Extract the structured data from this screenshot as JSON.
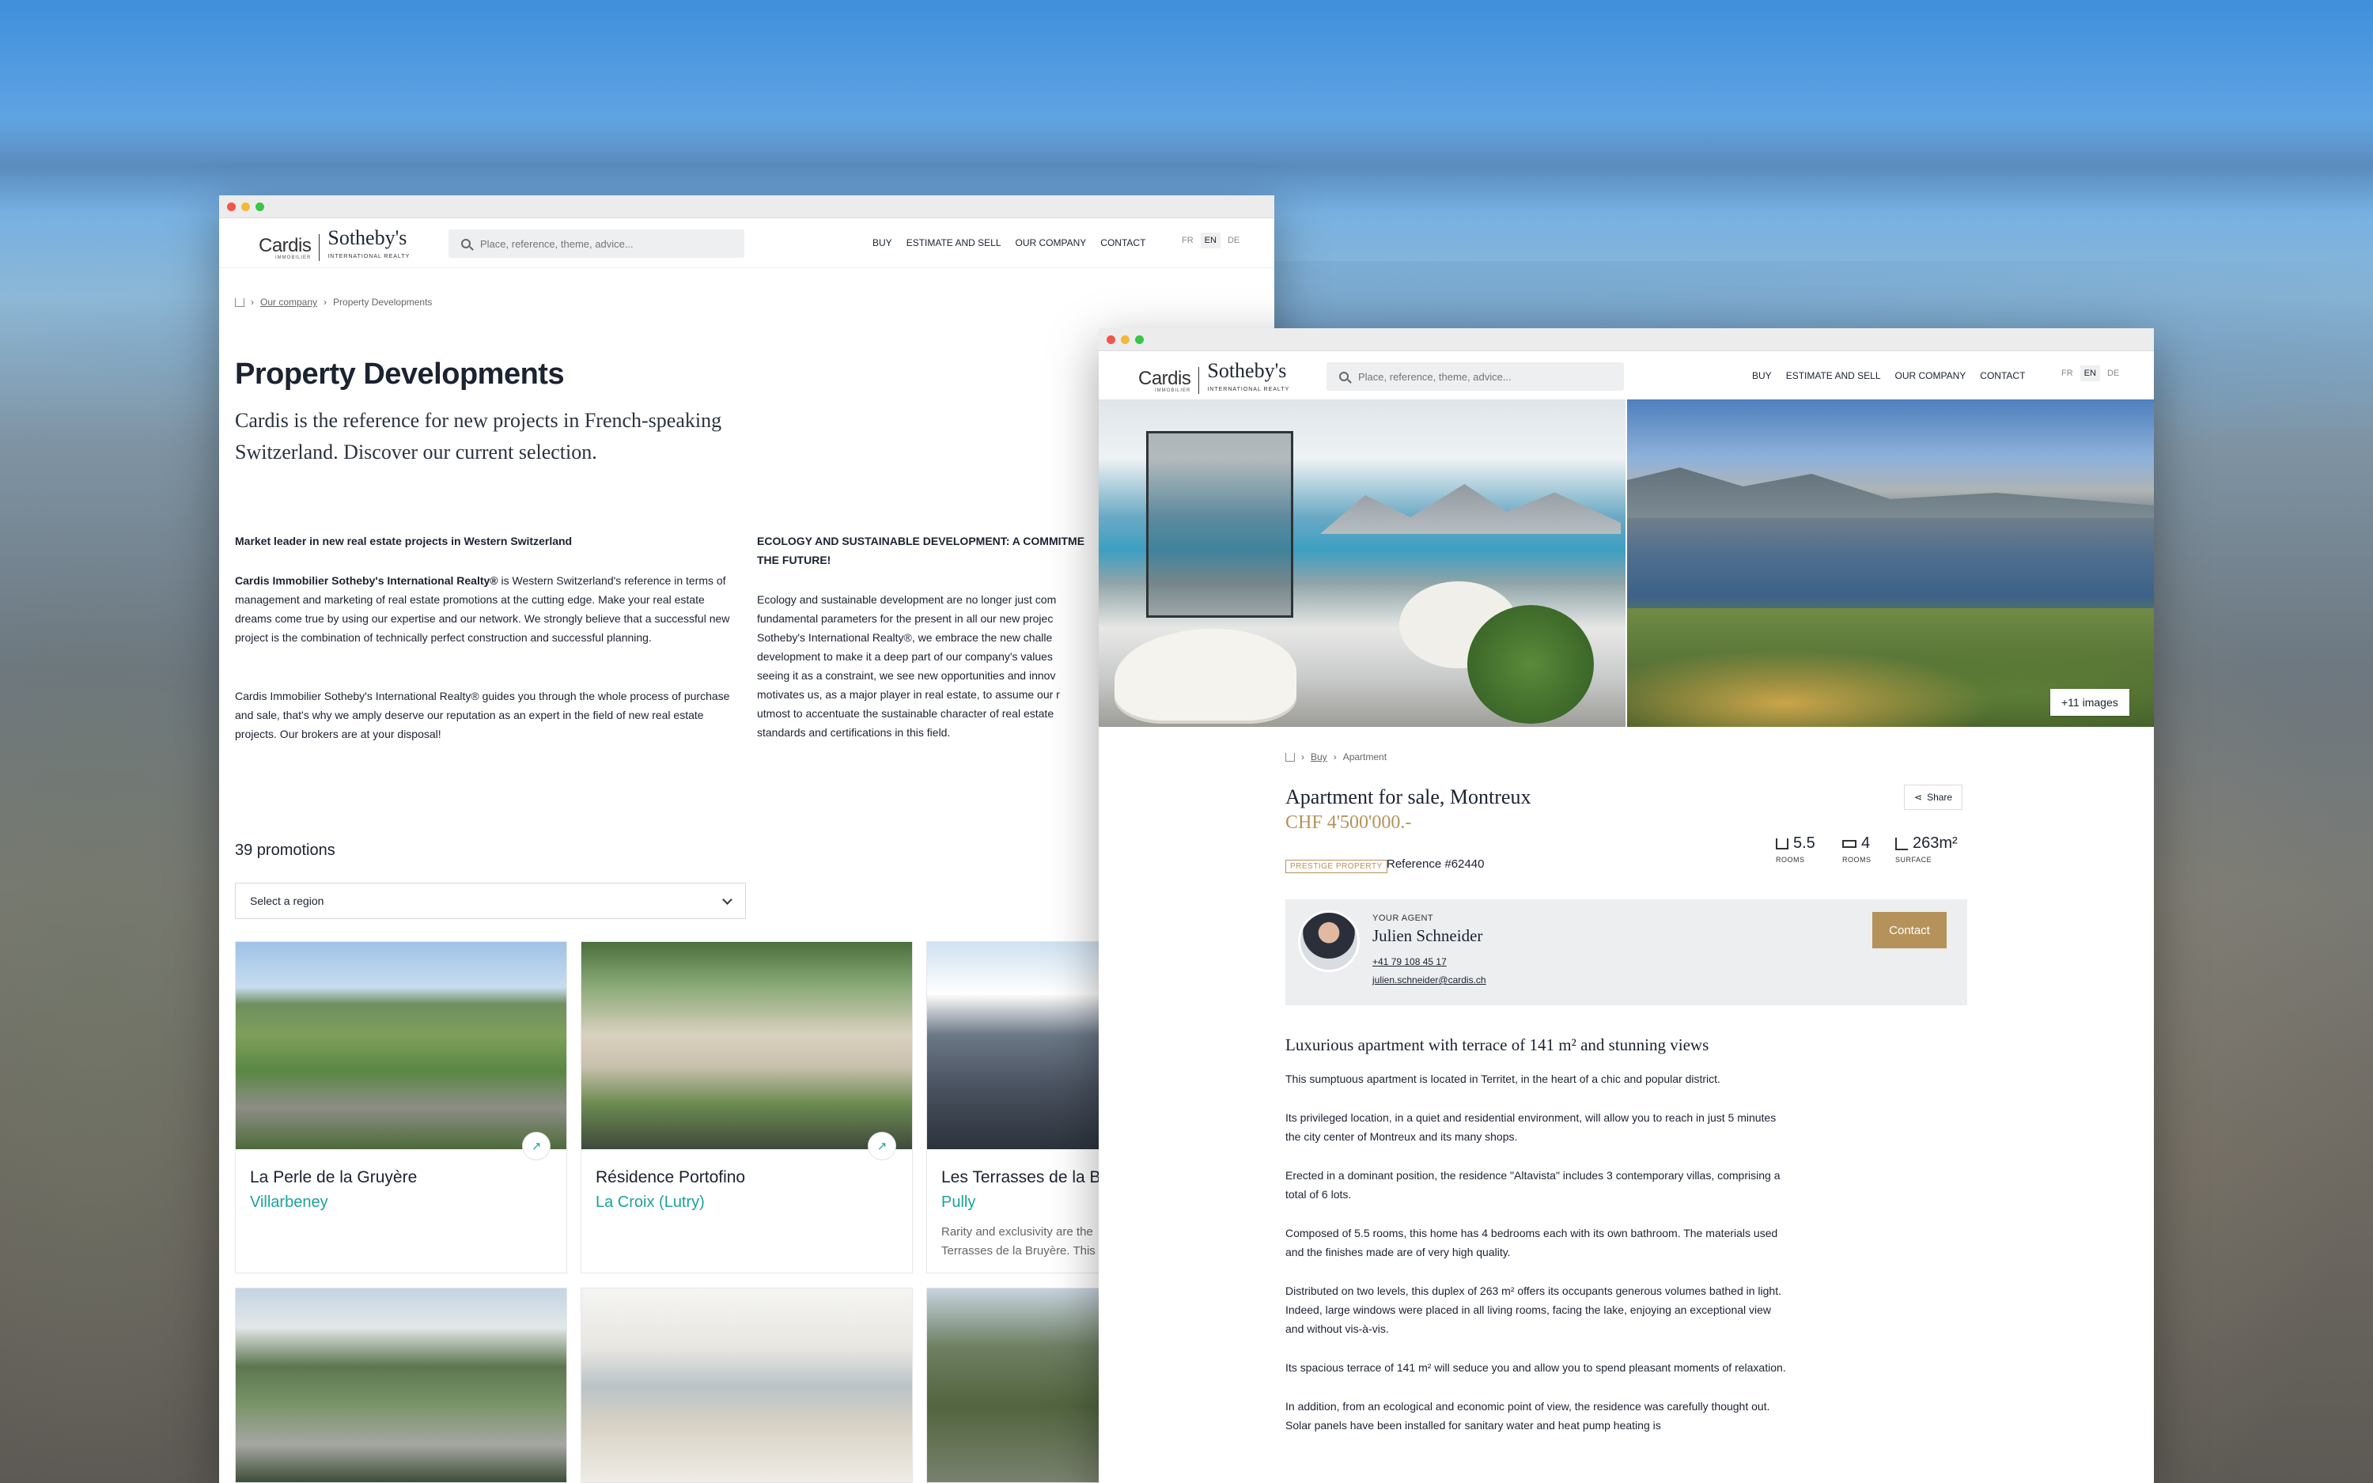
{
  "colors": {
    "teal": "#1aa39a",
    "gold": "#b6925b",
    "text": "#1b2230"
  },
  "brand": {
    "cardis": "Cardis",
    "cardis_sub": "IMMOBILIER",
    "sothebys": "Sotheby's",
    "sothebys_sub": "INTERNATIONAL REALTY"
  },
  "search": {
    "placeholder": "Place, reference, theme, advice..."
  },
  "nav": {
    "buy": "BUY",
    "estimate": "ESTIMATE AND SELL",
    "company": "OUR COMPANY",
    "contact": "CONTACT"
  },
  "langs": {
    "fr": "FR",
    "en": "EN",
    "de": "DE",
    "active": "EN"
  },
  "left": {
    "breadcrumb": {
      "company": "Our company",
      "current": "Property Developments"
    },
    "title": "Property Developments",
    "lede": "Cardis is the reference for new projects in French-speaking Switzerland. Discover our current selection.",
    "col1_heading": "Market leader in new real estate projects in Western Switzerland",
    "col1_p1_bold": "Cardis Immobilier Sotheby's International Realty®",
    "col1_p1_rest": " is Western Switzerland's reference in terms of management and marketing of real estate promotions at the cutting edge. Make your real estate dreams come true by using our expertise and our network. We strongly believe that a successful new project is the combination of technically perfect construction and successful planning.",
    "col1_p2": "Cardis Immobilier Sotheby's International Realty® guides you through the whole process of purchase and sale, that's why we amply deserve our reputation as an expert in the field of new real estate projects. Our brokers are at your disposal!",
    "col2_heading": "ECOLOGY AND SUSTAINABLE DEVELOPMENT: A COMMITME THE FUTURE!",
    "col2_lines": [
      "Ecology and sustainable development are no longer just com",
      "fundamental parameters for the present in all our new projec",
      "Sotheby's International Realty®, we embrace the new challe",
      "development to make it a deep part of our company's values",
      "seeing it as a constraint, we see new opportunities and innov",
      "motivates us, as a major player in real estate, to assume our r",
      "utmost to accentuate the sustainable character of real estate",
      "standards and certifications in this field."
    ],
    "promotions_count": "39 promotions",
    "region_select": "Select a region",
    "cards": [
      {
        "name": "La Perle de la Gruyère",
        "town": "Villarbeney",
        "desc": ""
      },
      {
        "name": "Résidence Portofino",
        "town": "La Croix (Lutry)",
        "desc": ""
      },
      {
        "name": "Les Terrasses de la Br",
        "town": "Pully",
        "desc1": "Rarity and exclusivity are the",
        "desc2": "Terrasses de la Bruyère. This"
      }
    ]
  },
  "right": {
    "more_images": "+11 images",
    "breadcrumb": {
      "buy": "Buy",
      "current": "Apartment"
    },
    "title": "Apartment for sale, Montreux",
    "price": "CHF 4'500'000.-",
    "share": "Share",
    "prestige": "PRESTIGE PROPERTY",
    "reference": "Reference #62440",
    "stats": [
      {
        "value": "5.5",
        "label": "ROOMS"
      },
      {
        "value": "4",
        "label": "ROOMS"
      },
      {
        "value": "263m²",
        "label": "SURFACE"
      }
    ],
    "agent": {
      "label": "YOUR AGENT",
      "name": "Julien Schneider",
      "phone": "+41 79 108 45 17",
      "email": "julien.schneider@cardis.ch",
      "contact": "Contact"
    },
    "subtitle": "Luxurious apartment with terrace of 141 m² and stunning views",
    "paragraphs": [
      "This sumptuous apartment is located in Territet, in the heart of a chic and popular district.",
      "Its privileged location, in a quiet and residential environment, will allow you to reach in just 5 minutes the city center of Montreux and its many shops.",
      "Erected in a dominant position, the residence \"Altavista\" includes 3 contemporary villas, comprising a total of 6 lots.",
      "Composed of 5.5 rooms, this home has 4 bedrooms each with its own bathroom. The materials used and the finishes made are of very high quality.",
      "Distributed on two levels, this duplex of 263 m² offers its occupants generous volumes bathed in light. Indeed, large windows were placed in all living rooms, facing the lake, enjoying an exceptional view and without vis-à-vis.",
      "Its spacious terrace of 141 m² will seduce you and allow you to spend pleasant moments of relaxation.",
      "In addition, from an ecological and economic point of view, the residence was carefully thought out. Solar panels have been installed for sanitary water and heat pump heating is"
    ]
  }
}
